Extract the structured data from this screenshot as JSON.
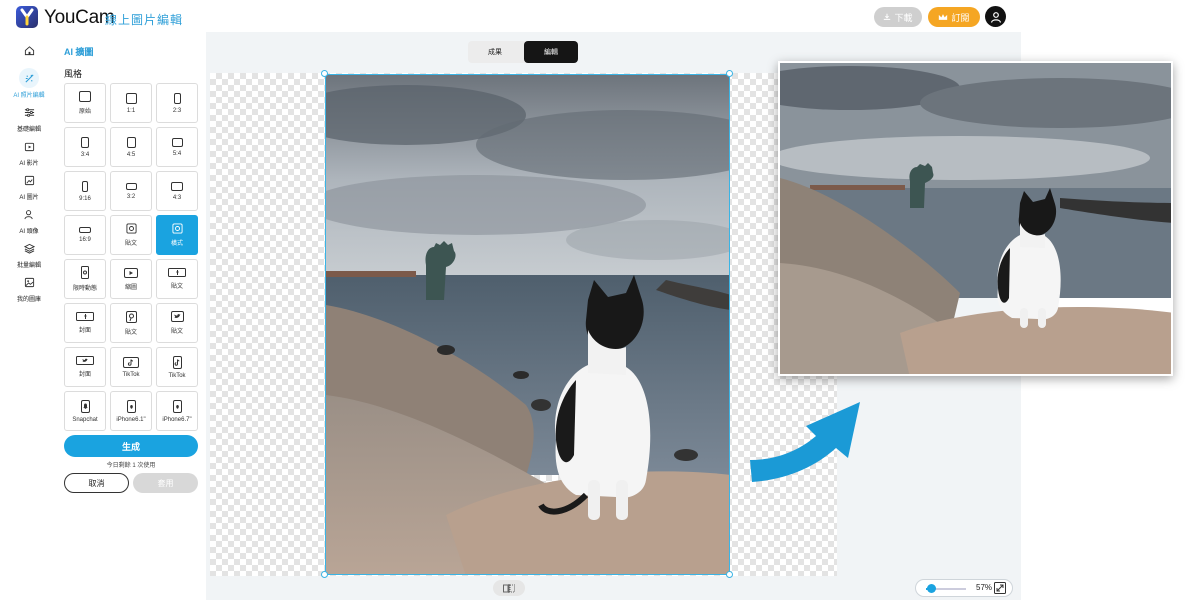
{
  "header": {
    "brand": "YouCam",
    "brand_sub": "線上圖片編輯",
    "download_label": "下載",
    "subscribe_label": "訂閱"
  },
  "nav": {
    "items": [
      {
        "label": "",
        "icon": "home-icon"
      },
      {
        "label": "AI 照片編輯",
        "icon": "ai-photo-edit-icon",
        "active": true
      },
      {
        "label": "基礎編輯",
        "icon": "sliders-icon"
      },
      {
        "label": "AI 影片",
        "icon": "video-icon"
      },
      {
        "label": "AI 圖片",
        "icon": "image-ai-icon"
      },
      {
        "label": "AI 頭像",
        "icon": "portrait-icon"
      },
      {
        "label": "批量編輯",
        "icon": "layers-icon"
      },
      {
        "label": "我的圖庫",
        "icon": "gallery-icon"
      }
    ]
  },
  "panel": {
    "title": "AI 擴圖",
    "subtitle": "風格",
    "styles": [
      {
        "label": "原始",
        "icon": "ratio-original-icon"
      },
      {
        "label": "1:1",
        "icon": "ratio-1-1-icon"
      },
      {
        "label": "2:3",
        "icon": "ratio-2-3-icon"
      },
      {
        "label": "3:4",
        "icon": "ratio-3-4-icon"
      },
      {
        "label": "4:5",
        "icon": "ratio-4-5-icon"
      },
      {
        "label": "5:4",
        "icon": "ratio-5-4-icon"
      },
      {
        "label": "9:16",
        "icon": "ratio-9-16-icon"
      },
      {
        "label": "3:2",
        "icon": "ratio-3-2-icon"
      },
      {
        "label": "4:3",
        "icon": "ratio-4-3-icon"
      },
      {
        "label": "16:9",
        "icon": "ratio-16-9-icon"
      },
      {
        "label": "貼文",
        "icon": "instagram-icon"
      },
      {
        "label": "橫式",
        "icon": "instagram-icon",
        "active": true
      },
      {
        "label": "限時動態",
        "icon": "instagram-story-icon"
      },
      {
        "label": "縮圖",
        "icon": "youtube-icon"
      },
      {
        "label": "貼文",
        "icon": "facebook-icon"
      },
      {
        "label": "封面",
        "icon": "facebook-cover-icon"
      },
      {
        "label": "貼文",
        "icon": "pinterest-icon"
      },
      {
        "label": "貼文",
        "icon": "twitter-icon"
      },
      {
        "label": "封面",
        "icon": "twitter-cover-icon"
      },
      {
        "label": "TikTok",
        "icon": "tiktok-icon"
      },
      {
        "label": "TikTok",
        "icon": "tiktok-portrait-icon"
      },
      {
        "label": "Snapchat",
        "icon": "snapchat-icon"
      },
      {
        "label": "iPhone6.1\"",
        "icon": "iphone-61-icon"
      },
      {
        "label": "iPhone6.7\"",
        "icon": "iphone-67-icon"
      }
    ],
    "generate_label": "生成",
    "quota_text": "今日剩餘 1 次使用",
    "cancel_label": "取消",
    "apply_label": "套用"
  },
  "workspace": {
    "tab_result": "成果",
    "tab_edit": "編輯",
    "active_tab": "編輯",
    "zoom_text": "57%",
    "zoom_level": 0.57
  },
  "colors": {
    "accent": "#1aa3e0",
    "subscribe": "#f5a623",
    "arrow": "#1b9ad6"
  }
}
